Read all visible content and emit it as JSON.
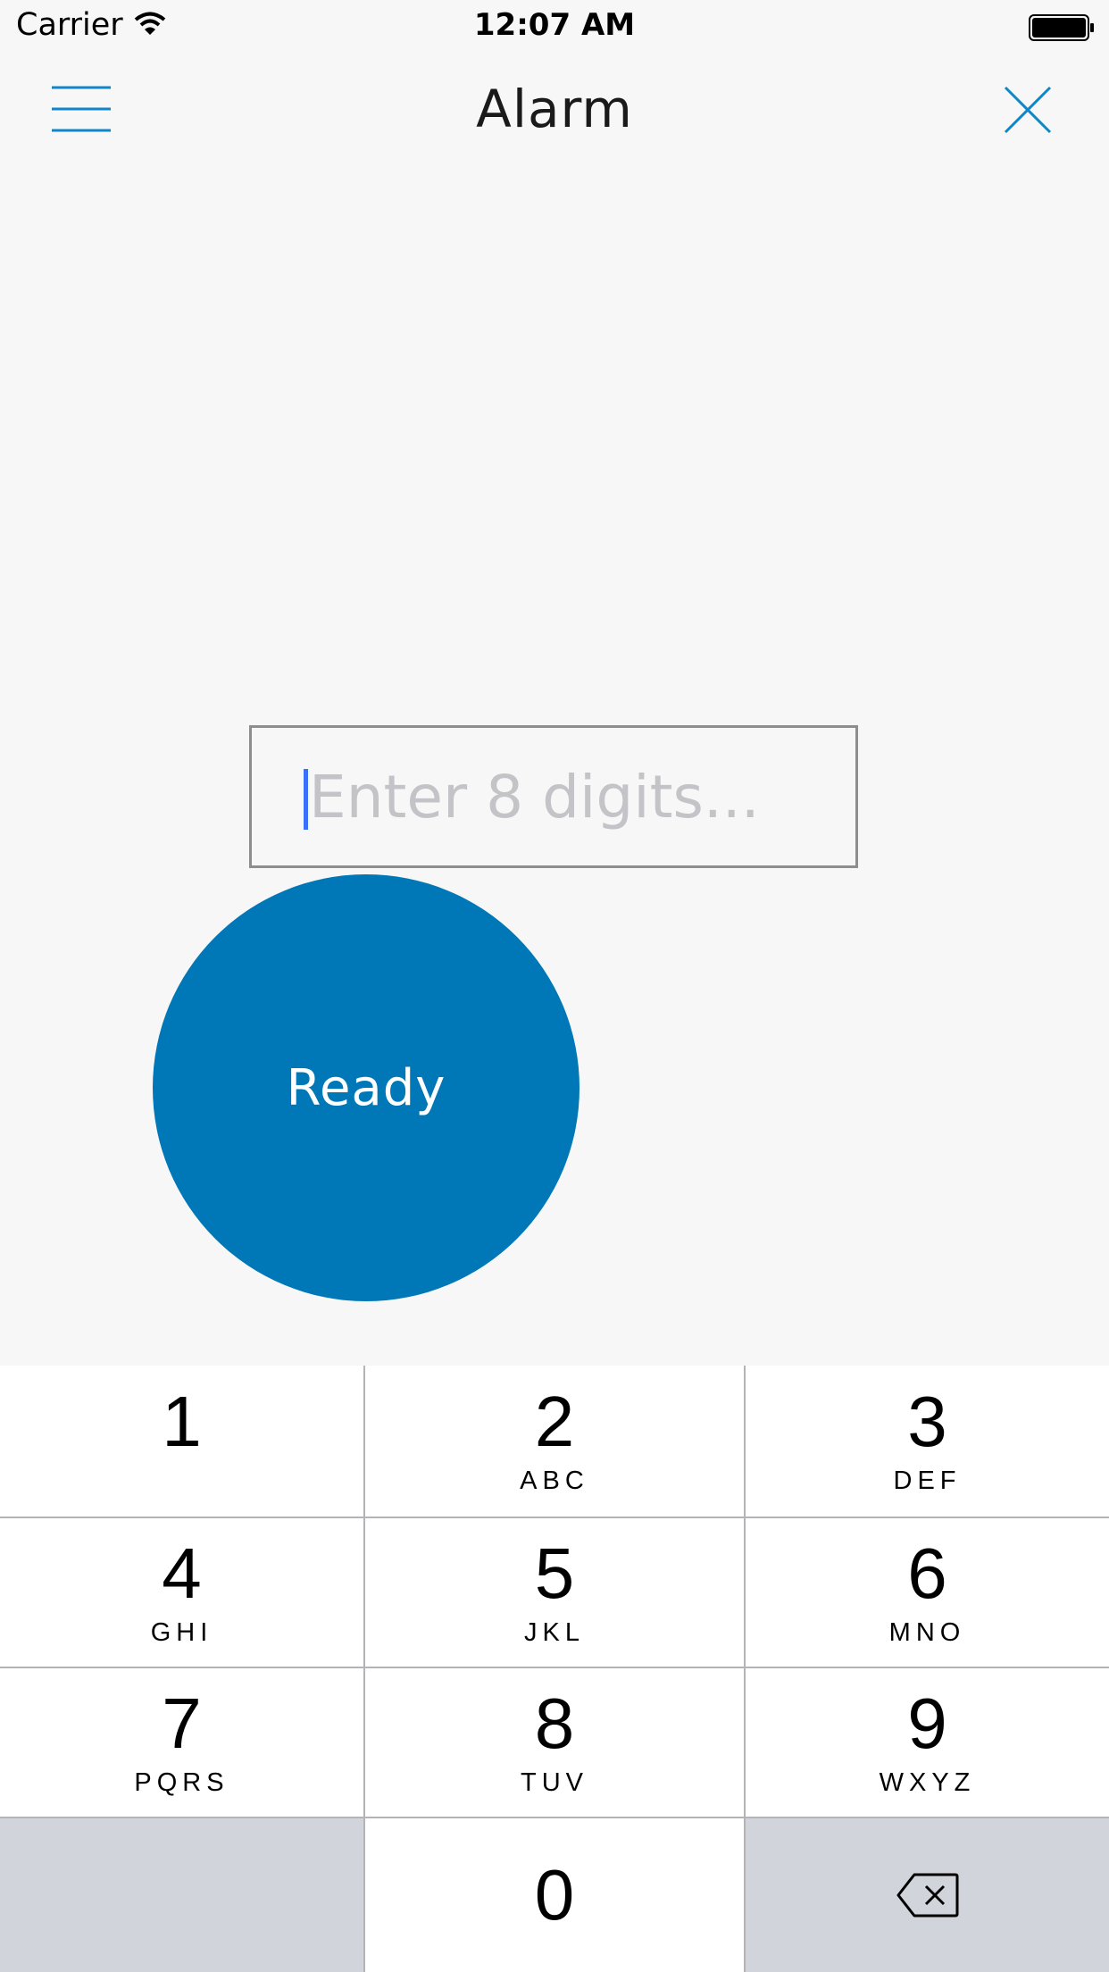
{
  "status_bar": {
    "carrier": "Carrier",
    "time": "12:07 AM"
  },
  "nav": {
    "title": "Alarm",
    "menu_icon": "hamburger-menu-icon",
    "close_icon": "close-icon"
  },
  "code_input": {
    "value": "",
    "placeholder": "Enter 8 digits..."
  },
  "ready_button": {
    "label": "Ready",
    "color": "#0077b6"
  },
  "keypad": {
    "keys": [
      {
        "digit": "1",
        "letters": ""
      },
      {
        "digit": "2",
        "letters": "ABC"
      },
      {
        "digit": "3",
        "letters": "DEF"
      },
      {
        "digit": "4",
        "letters": "GHI"
      },
      {
        "digit": "5",
        "letters": "JKL"
      },
      {
        "digit": "6",
        "letters": "MNO"
      },
      {
        "digit": "7",
        "letters": "PQRS"
      },
      {
        "digit": "8",
        "letters": "TUV"
      },
      {
        "digit": "9",
        "letters": "WXYZ"
      },
      {
        "digit": "0",
        "letters": ""
      }
    ],
    "backspace_icon": "backspace-icon"
  }
}
